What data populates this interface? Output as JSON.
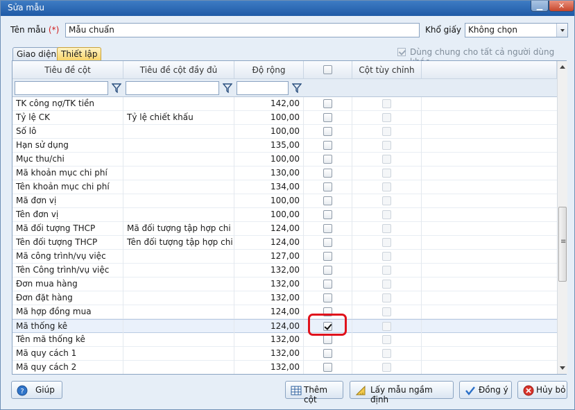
{
  "window": {
    "title": "Sửa mẫu"
  },
  "form": {
    "name_label": "Tên mẫu",
    "required_mark": "(*)",
    "name_value": "Mẫu chuẩn",
    "paper_label": "Khổ giấy",
    "paper_value": "Không chọn"
  },
  "tabs": [
    {
      "label": "Giao diện"
    },
    {
      "label": "Thiết lập"
    }
  ],
  "share_label": "Dùng chung cho tất cả người dùng khác",
  "columns": {
    "title": "Tiêu đề cột",
    "full_title": "Tiêu đề cột đầy đủ",
    "width": "Độ rộng",
    "custom": "Cột tùy chỉnh"
  },
  "rows": [
    {
      "title": "TK công nợ/TK tiền",
      "full": "",
      "width": "142,00",
      "checked": false
    },
    {
      "title": "Tỷ lệ CK",
      "full": "Tỷ lệ chiết khấu",
      "width": "100,00",
      "checked": false
    },
    {
      "title": "Số lô",
      "full": "",
      "width": "100,00",
      "checked": false
    },
    {
      "title": "Hạn sử dụng",
      "full": "",
      "width": "135,00",
      "checked": false
    },
    {
      "title": "Mục thu/chi",
      "full": "",
      "width": "100,00",
      "checked": false
    },
    {
      "title": "Mã khoản mục chi phí",
      "full": "",
      "width": "130,00",
      "checked": false
    },
    {
      "title": "Tên khoản mục chi phí",
      "full": "",
      "width": "134,00",
      "checked": false
    },
    {
      "title": "Mã đơn vị",
      "full": "",
      "width": "100,00",
      "checked": false
    },
    {
      "title": "Tên đơn vị",
      "full": "",
      "width": "100,00",
      "checked": false
    },
    {
      "title": "Mã đối tượng THCP",
      "full": "Mã đối tượng tập hợp chi ph",
      "width": "124,00",
      "checked": false
    },
    {
      "title": "Tên đối tượng THCP",
      "full": "Tên đối tượng tập hợp chi p",
      "width": "124,00",
      "checked": false
    },
    {
      "title": "Mã công trình/vụ việc",
      "full": "",
      "width": "127,00",
      "checked": false
    },
    {
      "title": "Tên Công trình/vụ việc",
      "full": "",
      "width": "132,00",
      "checked": false
    },
    {
      "title": "Đơn mua hàng",
      "full": "",
      "width": "132,00",
      "checked": false
    },
    {
      "title": "Đơn đặt hàng",
      "full": "",
      "width": "132,00",
      "checked": false
    },
    {
      "title": "Mã hợp đồng mua",
      "full": "",
      "width": "124,00",
      "checked": false
    },
    {
      "title": "Mã thống kê",
      "full": "",
      "width": "124,00",
      "checked": true
    },
    {
      "title": "Tên mã thống kê",
      "full": "",
      "width": "132,00",
      "checked": false
    },
    {
      "title": "Mã quy cách 1",
      "full": "",
      "width": "132,00",
      "checked": false
    },
    {
      "title": "Mã quy cách 2",
      "full": "",
      "width": "132,00",
      "checked": false
    }
  ],
  "buttons": {
    "help": "Giúp",
    "add_column": "Thêm cột",
    "default_template": "Lấy mẫu ngầm định",
    "ok": "Đồng ý",
    "cancel": "Hủy bỏ"
  }
}
